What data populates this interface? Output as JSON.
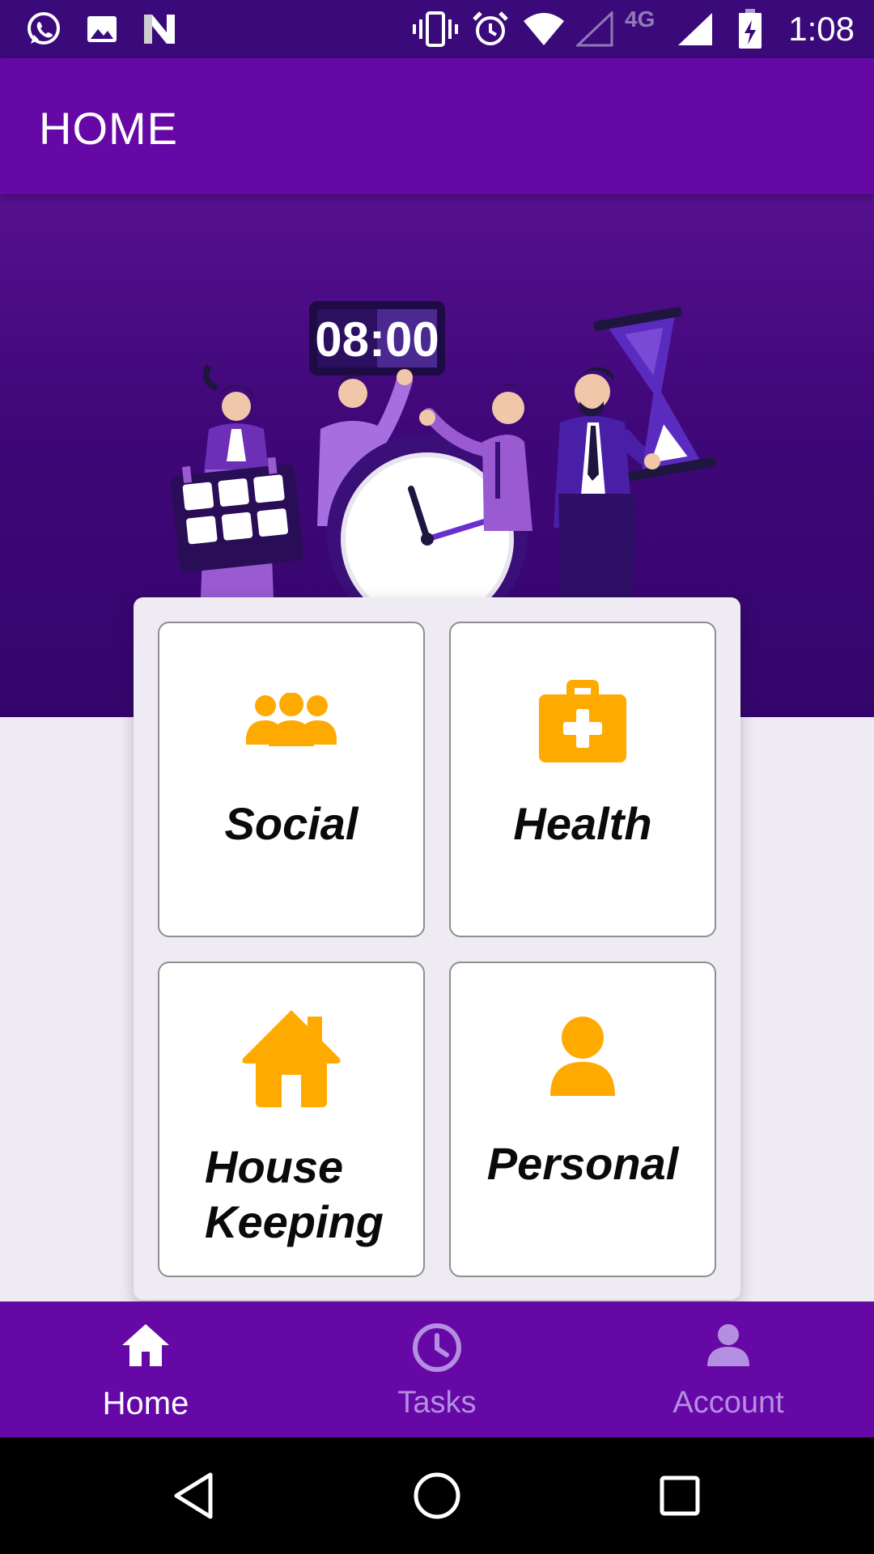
{
  "status_bar": {
    "time": "1:08",
    "network": "4G",
    "icons": [
      "whatsapp-icon",
      "gallery-icon",
      "n-icon",
      "vibrate-icon",
      "alarm-icon",
      "wifi-icon",
      "signal-empty-icon",
      "signal-icon",
      "battery-charging-icon"
    ]
  },
  "app_bar": {
    "title": "HOME"
  },
  "hero": {
    "clock_display": "08:00"
  },
  "categories": [
    {
      "label": "Social",
      "icon": "people-icon"
    },
    {
      "label": "Health",
      "icon": "medical-kit-icon"
    },
    {
      "label_line1": "House",
      "label_line2": "Keeping",
      "icon": "house-icon"
    },
    {
      "label": "Personal",
      "icon": "person-icon"
    }
  ],
  "bottom_nav": {
    "items": [
      {
        "label": "Home",
        "icon": "home-icon",
        "active": true
      },
      {
        "label": "Tasks",
        "icon": "clock-icon",
        "active": false
      },
      {
        "label": "Account",
        "icon": "account-icon",
        "active": false
      }
    ]
  },
  "colors": {
    "primary": "#6508a6",
    "status_bar": "#3a0a7a",
    "accent": "#ffaa00",
    "inactive_nav": "#b48ee0"
  }
}
